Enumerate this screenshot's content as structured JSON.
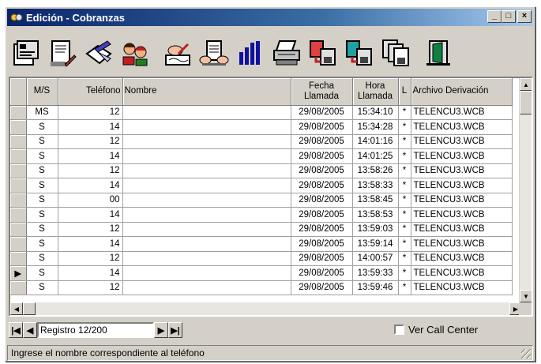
{
  "window": {
    "title": "Edición - Cobranzas",
    "min": "_",
    "max": "□",
    "close": "×"
  },
  "toolbar": {
    "buttons": [
      {
        "name": "properties-icon"
      },
      {
        "name": "document-pen-icon"
      },
      {
        "name": "envelope-pen-icon"
      },
      {
        "name": "people-talk-icon"
      },
      {
        "name": "hand-write-icon"
      },
      {
        "name": "hands-document-icon"
      },
      {
        "name": "bar-chart-icon"
      },
      {
        "name": "printer-icon"
      },
      {
        "name": "transfer-red-icon"
      },
      {
        "name": "transfer-teal-icon"
      },
      {
        "name": "copy-icon"
      },
      {
        "name": "exit-door-icon"
      }
    ]
  },
  "grid": {
    "headers": {
      "ms": "M/S",
      "telefono": "Teléfono",
      "nombre": "Nombre",
      "fecha_1": "Fecha",
      "fecha_2": "Llamada",
      "hora_1": "Hora",
      "hora_2": "Llamada",
      "l": "L",
      "archivo": "Archivo Derivación"
    },
    "rows": [
      {
        "ms": "MS",
        "telefono": "12",
        "nombre": "",
        "fecha": "29/08/2005",
        "hora": "15:34:10",
        "l": "*",
        "archivo": "TELENCU3.WCB",
        "indicator": ""
      },
      {
        "ms": "S",
        "telefono": "14",
        "nombre": "",
        "fecha": "29/08/2005",
        "hora": "15:34:28",
        "l": "*",
        "archivo": "TELENCU3.WCB",
        "indicator": ""
      },
      {
        "ms": "S",
        "telefono": "12",
        "nombre": "",
        "fecha": "29/08/2005",
        "hora": "14:01:16",
        "l": "*",
        "archivo": "TELENCU3.WCB",
        "indicator": ""
      },
      {
        "ms": "S",
        "telefono": "14",
        "nombre": "",
        "fecha": "29/08/2005",
        "hora": "14:01:25",
        "l": "*",
        "archivo": "TELENCU3.WCB",
        "indicator": ""
      },
      {
        "ms": "S",
        "telefono": "12",
        "nombre": "",
        "fecha": "29/08/2005",
        "hora": "13:58:26",
        "l": "*",
        "archivo": "TELENCU3.WCB",
        "indicator": ""
      },
      {
        "ms": "S",
        "telefono": "14",
        "nombre": "",
        "fecha": "29/08/2005",
        "hora": "13:58:33",
        "l": "*",
        "archivo": "TELENCU3.WCB",
        "indicator": ""
      },
      {
        "ms": "S",
        "telefono": "00",
        "nombre": "",
        "fecha": "29/08/2005",
        "hora": "13:58:45",
        "l": "*",
        "archivo": "TELENCU3.WCB",
        "indicator": ""
      },
      {
        "ms": "S",
        "telefono": "14",
        "nombre": "",
        "fecha": "29/08/2005",
        "hora": "13:58:53",
        "l": "*",
        "archivo": "TELENCU3.WCB",
        "indicator": ""
      },
      {
        "ms": "S",
        "telefono": "12",
        "nombre": "",
        "fecha": "29/08/2005",
        "hora": "13:59:03",
        "l": "*",
        "archivo": "TELENCU3.WCB",
        "indicator": ""
      },
      {
        "ms": "S",
        "telefono": "14",
        "nombre": "",
        "fecha": "29/08/2005",
        "hora": "13:59:14",
        "l": "*",
        "archivo": "TELENCU3.WCB",
        "indicator": ""
      },
      {
        "ms": "S",
        "telefono": "12",
        "nombre": "",
        "fecha": "29/08/2005",
        "hora": "14:00:57",
        "l": "*",
        "archivo": "TELENCU3.WCB",
        "indicator": ""
      },
      {
        "ms": "S",
        "telefono": "14",
        "nombre": "",
        "fecha": "29/08/2005",
        "hora": "13:59:33",
        "l": "*",
        "archivo": "TELENCU3.WCB",
        "indicator": "▶"
      },
      {
        "ms": "S",
        "telefono": "12",
        "nombre": "",
        "fecha": "29/08/2005",
        "hora": "13:59:46",
        "l": "*",
        "archivo": "TELENCU3.WCB",
        "indicator": ""
      }
    ]
  },
  "nav": {
    "first": "|◀",
    "prev": "◀",
    "record": "Registro 12/200",
    "next": "▶",
    "last": "▶|"
  },
  "call_center": {
    "label": "Ver Call Center",
    "checked": false
  },
  "status": {
    "text": "Ingrese el nombre correspondiente al teléfono"
  },
  "colors": {
    "title_start": "#0a246a",
    "title_end": "#a6caf0",
    "face": "#d4d0c8"
  }
}
